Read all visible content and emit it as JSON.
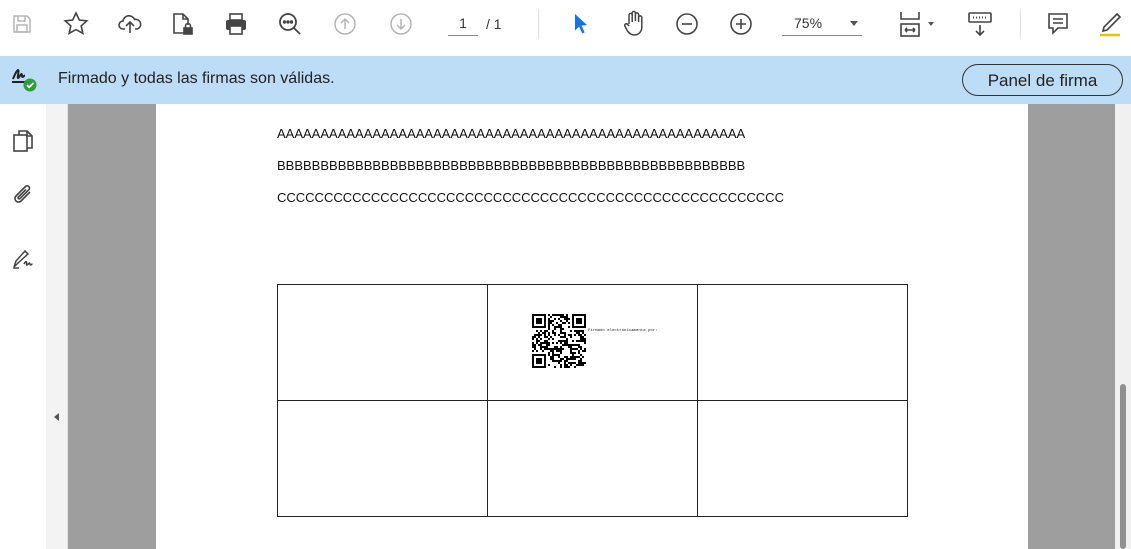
{
  "toolbar": {
    "page_current": "1",
    "page_total": "/ 1",
    "zoom": "75%",
    "icons": [
      "save-icon",
      "bookmark-star-icon",
      "cloud-upload-icon",
      "protect-file-icon",
      "print-icon",
      "zoom-search-icon",
      "page-up-icon",
      "page-down-icon",
      "select-cursor-icon",
      "hand-tool-icon",
      "zoom-out-icon",
      "zoom-in-icon",
      "page-fit-icon",
      "scroll-mode-icon",
      "comment-icon",
      "highlight-pen-icon"
    ]
  },
  "signature_bar": {
    "message": "Firmado y todas las firmas son válidas.",
    "button_label": "Panel de firma",
    "bg_color": "#bddcf5",
    "status_color": "#2e9e3e"
  },
  "rail": {
    "icons": [
      "pages-icon",
      "attachment-icon",
      "signature-icon"
    ]
  },
  "document": {
    "lines": [
      "AAAAAAAAAAAAAAAAAAAAAAAAAAAAAAAAAAAAAAAAAAAAAAAAAAAAAA",
      "BBBBBBBBBBBBBBBBBBBBBBBBBBBBBBBBBBBBBBBBBBBBBBBBBBBBBB",
      "CCCCCCCCCCCCCCCCCCCCCCCCCCCCCCCCCCCCCCCCCCCCCCCCCCCCCC"
    ],
    "qr_caption": "Firmado electrónicamente por:"
  }
}
